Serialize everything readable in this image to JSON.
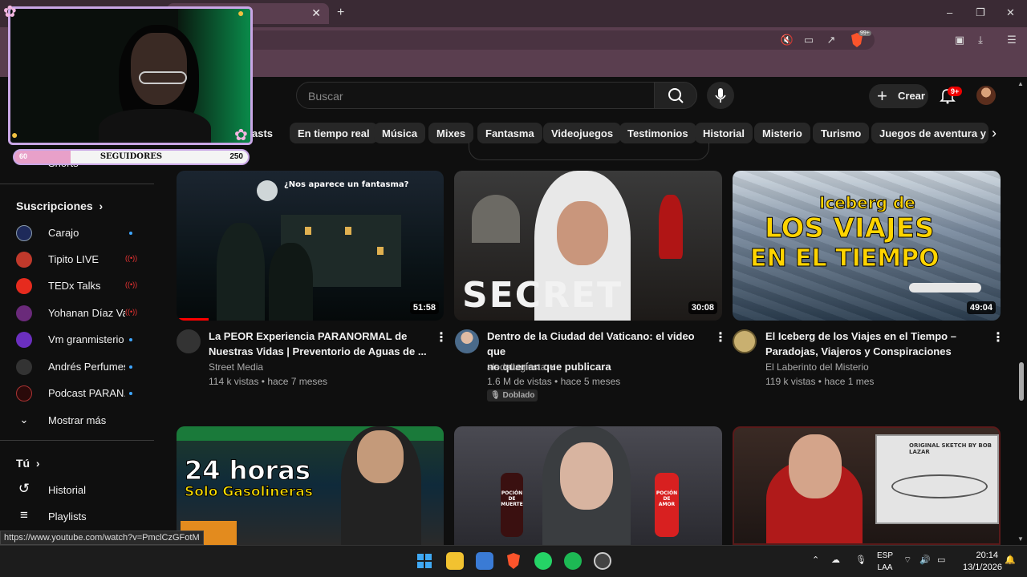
{
  "browser": {
    "new_tab_glyph": "+",
    "tab_close_glyph": "✕",
    "window_controls": [
      "–",
      "❐",
      "✕"
    ],
    "brave_shield_count": "99+"
  },
  "header": {
    "search_placeholder": "Buscar",
    "create_label": "Crear",
    "notification_badge": "9+"
  },
  "chips": [
    {
      "label": "asts"
    },
    {
      "label": "En tiempo real"
    },
    {
      "label": "Música"
    },
    {
      "label": "Mixes"
    },
    {
      "label": "Fantasma"
    },
    {
      "label": "Videojuegos"
    },
    {
      "label": "Testimonios"
    },
    {
      "label": "Historial"
    },
    {
      "label": "Misterio"
    },
    {
      "label": "Turismo"
    },
    {
      "label": "Juegos de aventura y acci"
    }
  ],
  "overlay": {
    "followers_label": "SEGUIDORES",
    "followers_current": "60",
    "followers_goal": "250",
    "progress_fraction": 0.24
  },
  "sidebar": {
    "shorts_label": "Shorts",
    "subscriptions_heading": "Suscripciones",
    "subscriptions": [
      {
        "label": "Carajo",
        "status": "new",
        "color": "#1e2a5a"
      },
      {
        "label": "Tipito LIVE",
        "status": "live",
        "color": "#c0392b"
      },
      {
        "label": "TEDx Talks",
        "status": "live",
        "color": "#e62b1e"
      },
      {
        "label": "Yohanan Díaz Va...",
        "status": "live",
        "color": "#6a2a7a"
      },
      {
        "label": "Vm granmisterio",
        "status": "new",
        "color": "#6b2fbf"
      },
      {
        "label": "Andrés Perfumes",
        "status": "new",
        "color": "#333333"
      },
      {
        "label": "Podcast PARAN...",
        "status": "new",
        "color": "#2a0a0a"
      }
    ],
    "show_more": "Mostrar más",
    "you_heading": "Tú",
    "you_items": [
      {
        "label": "Historial"
      },
      {
        "label": "Playlists"
      }
    ]
  },
  "videos": [
    {
      "title_line1": "La PEOR Experiencia PARANORMAL de",
      "title_line2": "Nuestras Vidas | Preventorio de Aguas de ...",
      "channel": "Street Media",
      "meta": "114 k vistas • hace 7 meses",
      "duration": "51:58",
      "thumb_caption": "¿Nos aparece un fantasma?"
    },
    {
      "title_line1": "Dentro de la Ciudad del Vaticano: el video que",
      "title_line2": "no querían que publicara",
      "channel": "aledellagiusta",
      "meta": "1.6 M de vistas • hace 5 meses",
      "duration": "30:08",
      "thumb_caption": "SECRET",
      "badge": "Doblado"
    },
    {
      "title_line1": "El Iceberg de los Viajes en el Tiempo –",
      "title_line2": "Paradojas, Viajeros y Conspiraciones",
      "channel": "El Laberinto del Misterio",
      "meta": "119 k vistas • hace 1 mes",
      "duration": "49:04",
      "thumb_caption_1": "Iceberg de",
      "thumb_caption_2": "LOS VIAJES",
      "thumb_caption_3": "EN EL TIEMPO"
    },
    {
      "thumb_caption_1": "24 horas",
      "thumb_caption_2": "Solo Gasolineras"
    },
    {
      "thumb_caption_1": "POCIÓN DE MUERTE",
      "thumb_caption_2": "POCIÓN DE AMOR"
    },
    {
      "thumb_caption_1": "ORIGINAL SKETCH BY BOB LAZAR"
    }
  ],
  "status_url": "https://www.youtube.com/watch?v=PmclCzGFotM",
  "taskbar": {
    "lang_1": "ESP",
    "lang_2": "LAA",
    "time": "20:14",
    "date": "13/1/2026"
  }
}
